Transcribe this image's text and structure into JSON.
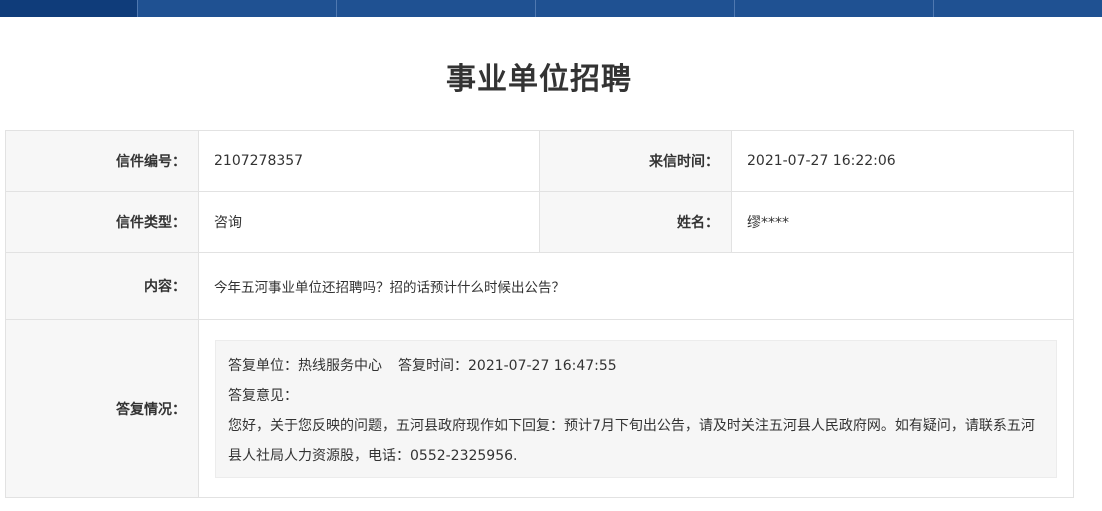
{
  "page": {
    "title": "事业单位招聘"
  },
  "letter": {
    "number_label": "信件编号：",
    "number": "2107278357",
    "time_label": "来信时间：",
    "time": "2021-07-27 16:22:06",
    "type_label": "信件类型：",
    "type": "咨询",
    "name_label": "姓名：",
    "name": "缪****",
    "content_label": "内容：",
    "content": "今年五河事业单位还招聘吗？招的话预计什么时候出公告？",
    "reply_label": "答复情况："
  },
  "reply": {
    "unit_label": "答复单位：",
    "unit": "热线服务中心",
    "time_label": "答复时间：",
    "time": "2021-07-27 16:47:55",
    "opinion_label": "答复意见：",
    "text": "您好，关于您反映的问题，五河县政府现作如下回复：预计7月下旬出公告，请及时关注五河县人民政府网。如有疑问，请联系五河县人社局人力资源股，电话：0552-2325956."
  },
  "colors": {
    "nav_bg": "#1f5192",
    "nav_active": "#0f3c7a",
    "label_bg": "#f7f7f7",
    "border": "#e2e2e2",
    "reply_bg": "#f6f6f6"
  }
}
